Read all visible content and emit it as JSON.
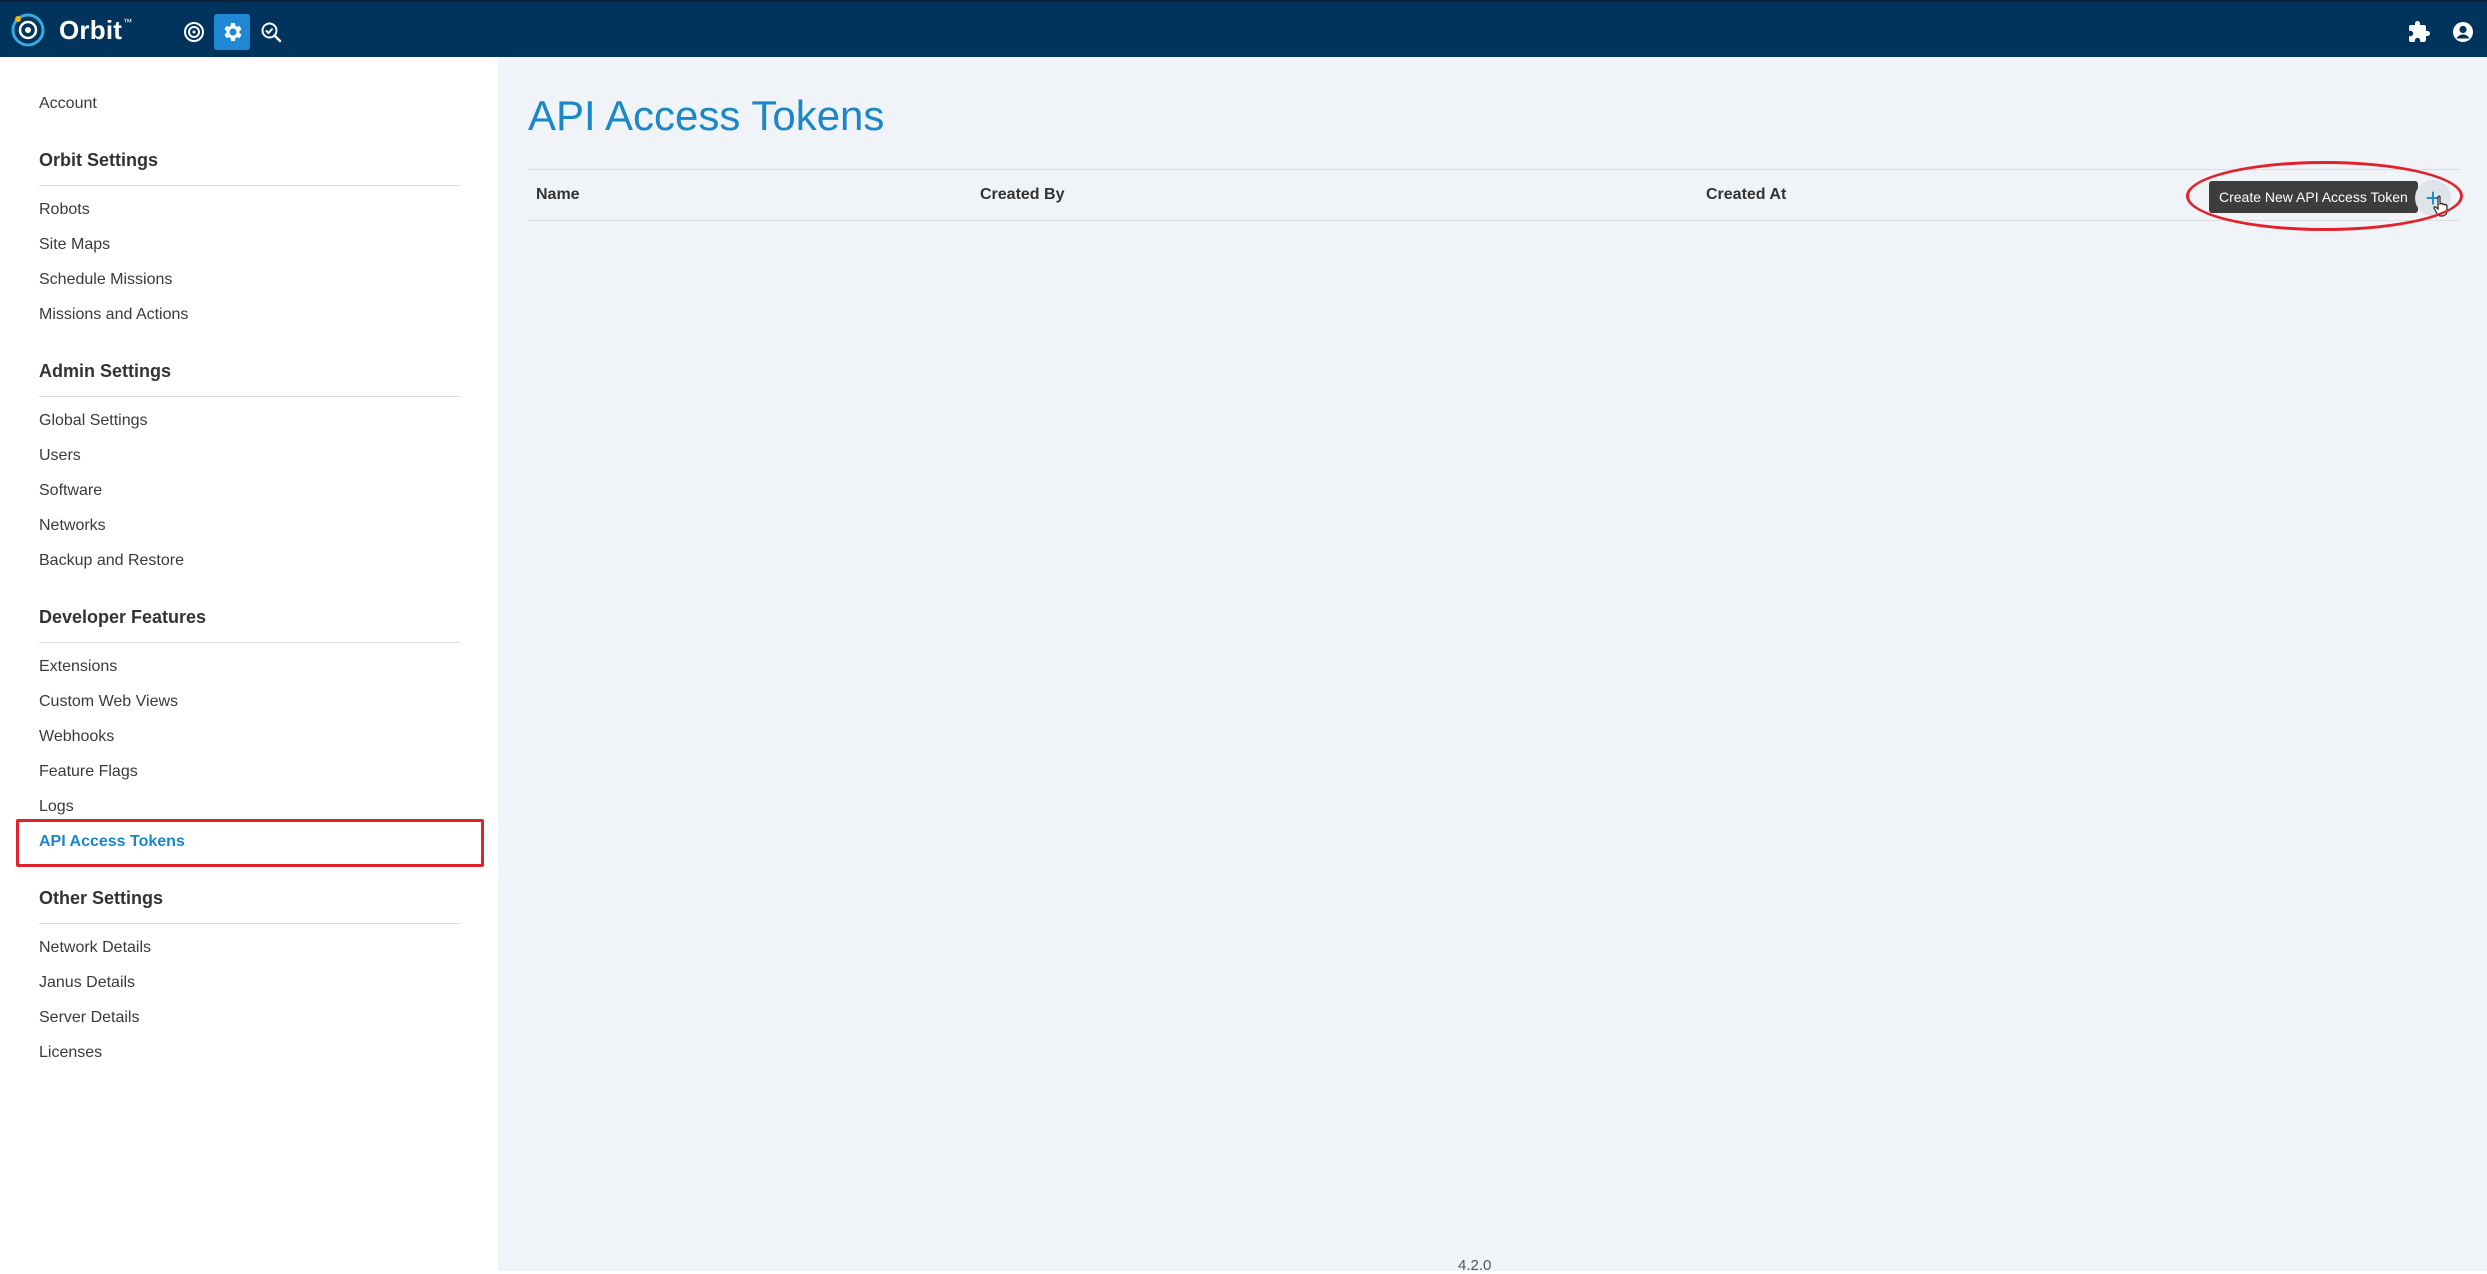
{
  "app": {
    "brand": "Orbit",
    "trademark": "™"
  },
  "topbar": {
    "nav_icons": [
      "target-icon",
      "gear-icon",
      "search-check-icon"
    ],
    "right_icons": [
      "puzzle-icon",
      "account-icon"
    ]
  },
  "sidebar": {
    "account": "Account",
    "sections": [
      {
        "heading": "Orbit Settings",
        "items": [
          "Robots",
          "Site Maps",
          "Schedule Missions",
          "Missions and Actions"
        ]
      },
      {
        "heading": "Admin Settings",
        "items": [
          "Global Settings",
          "Users",
          "Software",
          "Networks",
          "Backup and Restore"
        ]
      },
      {
        "heading": "Developer Features",
        "items": [
          "Extensions",
          "Custom Web Views",
          "Webhooks",
          "Feature Flags",
          "Logs",
          "API Access Tokens"
        ]
      },
      {
        "heading": "Other Settings",
        "items": [
          "Network Details",
          "Janus Details",
          "Server Details",
          "Licenses"
        ]
      }
    ],
    "active_item": "API Access Tokens"
  },
  "main": {
    "title": "API Access Tokens",
    "table": {
      "columns": [
        "Name",
        "Created By",
        "Created At"
      ],
      "rows": []
    },
    "add_button": {
      "icon": "plus-icon",
      "label": "+",
      "tooltip": "Create New API Access Token"
    },
    "version": "4.2.0"
  },
  "colors": {
    "topbar": "#00345c",
    "accent": "#1a87c9",
    "annotation": "#e0222a",
    "main_bg": "#f0f3f7"
  }
}
